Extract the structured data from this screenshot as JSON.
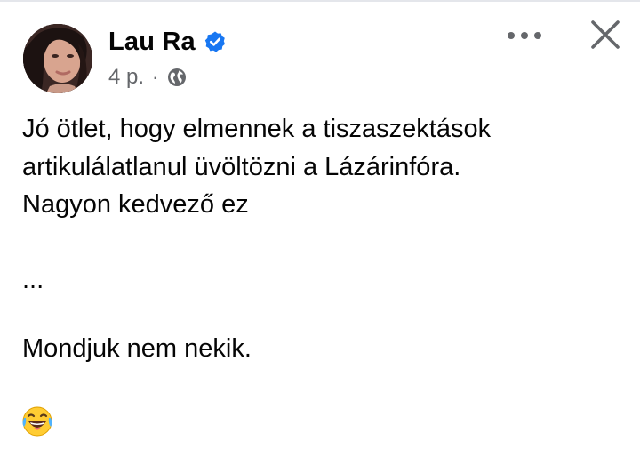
{
  "post": {
    "author": {
      "name": "Lau Ra",
      "verified_icon": "verified-badge-icon"
    },
    "meta": {
      "time": "4 p.",
      "separator": "·",
      "audience_icon": "globe-icon"
    },
    "actions": {
      "more_icon": "more-dots-icon",
      "close_icon": "close-icon"
    },
    "content": {
      "text": "Jó ötlet, hogy elmennek a tiszaszektások\nartikulálatlanul üvöltözni a Lázárinfóra.\nNagyon kedvező ez",
      "ellipsis": "...",
      "closing": "Mondjuk nem nekik.",
      "emoji": "😂"
    },
    "colors": {
      "text": "#050505",
      "secondary": "#65676b",
      "verified": "#1877f2",
      "background": "#ffffff"
    }
  }
}
